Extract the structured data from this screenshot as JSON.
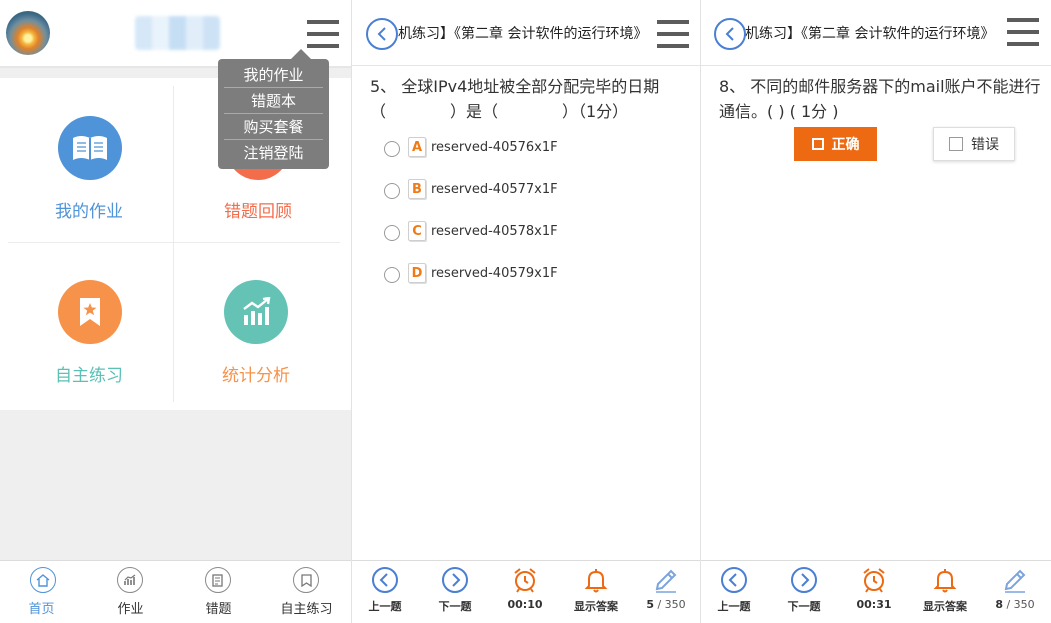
{
  "colors": {
    "accent_blue": "#4a7fd4",
    "orange": "#ee6a12",
    "homework": "#4f93d8",
    "wrong_review": "#f36c4b",
    "self_practice_icon": "#f7924a",
    "self_practice_label": "#5bc0b5",
    "stats_icon": "#64c3b5",
    "stats_label": "#f7924a"
  },
  "home": {
    "avatar": "avatar",
    "menu_icon": "hamburger-menu-icon",
    "dropdown": [
      "我的作业",
      "错题本",
      "购买套餐",
      "注销登陆"
    ],
    "tiles": [
      {
        "label": "我的作业",
        "icon": "book-icon"
      },
      {
        "label": "错题回顾",
        "icon": "review-icon"
      },
      {
        "label": "自主练习",
        "icon": "bookmark-star-icon"
      },
      {
        "label": "统计分析",
        "icon": "bar-chart-icon"
      }
    ],
    "bottom_nav": [
      {
        "label": "首页",
        "icon": "home-icon",
        "active": true
      },
      {
        "label": "作业",
        "icon": "chart-icon",
        "active": false
      },
      {
        "label": "错题",
        "icon": "notebook-icon",
        "active": false
      },
      {
        "label": "自主练习",
        "icon": "bookmark-icon",
        "active": false
      }
    ]
  },
  "q5": {
    "title": "机练习】《第二章 会计软件的运行环境》",
    "question": "5、 全球IPv4地址被全部分配完毕的日期（　　　　）是（　　　　）（1分）",
    "options": [
      {
        "letter": "A",
        "text": "reserved-40576x1F"
      },
      {
        "letter": "B",
        "text": "reserved-40577x1F"
      },
      {
        "letter": "C",
        "text": "reserved-40578x1F"
      },
      {
        "letter": "D",
        "text": "reserved-40579x1F"
      }
    ],
    "footer": {
      "prev": "上一题",
      "next": "下一题",
      "timer": "00:10",
      "show_answer": "显示答案",
      "page_current": "5",
      "page_total": " / 350"
    }
  },
  "q8": {
    "title": "机练习】《第二章 会计软件的运行环境》",
    "question": "8、 不同的邮件服务器下的mail账户不能进行通信。( ) ( 1分 )",
    "true_label": "正确",
    "false_label": "错误",
    "footer": {
      "prev": "上一题",
      "next": "下一题",
      "timer": "00:31",
      "show_answer": "显示答案",
      "page_current": "8",
      "page_total": " / 350"
    }
  }
}
